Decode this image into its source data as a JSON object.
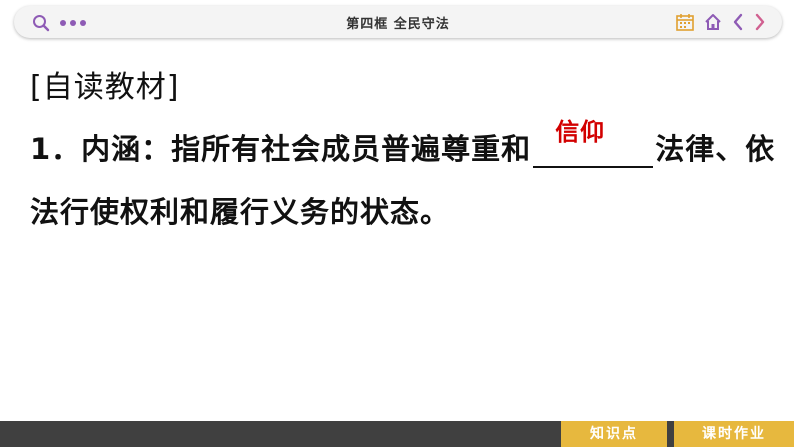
{
  "header": {
    "title": "第四框    全民守法",
    "icons": [
      "search-icon",
      "more-dots-icon",
      "calendar-icon",
      "home-icon",
      "prev-icon",
      "next-icon"
    ],
    "accent_color": "#8e5bb5"
  },
  "content": {
    "section_heading": "[自读教材]",
    "line1_prefix": "1．内涵：指所有社会成员普遍尊重和",
    "answer": "信仰",
    "line1_suffix": "法律、依",
    "line2": "法行使权利和履行义务的状态。",
    "answer_color": "#d20000"
  },
  "footer": {
    "knowledge_points": "知识点",
    "homework": "课时作业",
    "button_color": "#e7b83e"
  }
}
